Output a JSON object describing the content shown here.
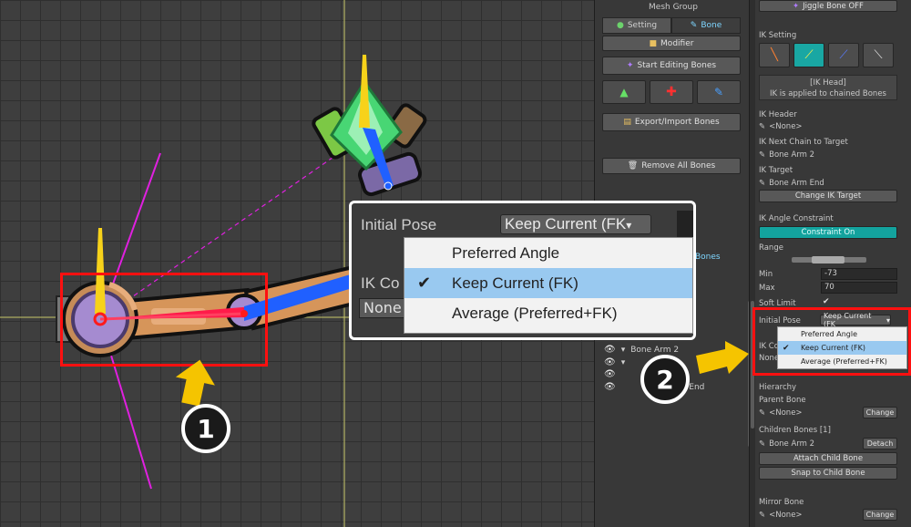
{
  "middle_panel": {
    "title": "Mesh Group",
    "tabs": [
      {
        "label": "Setting",
        "active": false
      },
      {
        "label": "Bone",
        "active": true
      }
    ],
    "modifier_label": "Modifier",
    "start_editing_label": "Start Editing Bones",
    "export_import_label": "Export/Import Bones",
    "remove_all_label": "Remove All Bones",
    "bones_tab_label": "Bones",
    "hierarchy": [
      {
        "label": "Bone Arm 2"
      },
      {
        "label": ""
      },
      {
        "label": "n End"
      }
    ]
  },
  "right_panel": {
    "jiggle_label": "Jiggle Bone OFF",
    "ik_setting_label": "IK Setting",
    "ik_tools": [
      "ik-single-icon",
      "ik-head-icon",
      "ik-chained-icon",
      "ik-disabled-icon"
    ],
    "info_line1": "[IK Head]",
    "info_line2": "IK is applied to chained Bones",
    "ik_header_label": "IK Header",
    "ik_header_value": "<None>",
    "ik_next_chain_label": "IK Next Chain to Target",
    "ik_next_chain_value": "Bone Arm 2",
    "ik_target_label": "IK Target",
    "ik_target_value": "Bone Arm End",
    "change_ik_target_label": "Change IK Target",
    "ik_angle_constraint_label": "IK Angle Constraint",
    "constraint_on_label": "Constraint On",
    "range_label": "Range",
    "min_label": "Min",
    "min_value": "-73",
    "max_label": "Max",
    "max_value": "70",
    "soft_limit_label": "Soft Limit",
    "initial_pose_label": "Initial Pose",
    "initial_pose_value": "Keep Current (FK",
    "ik_co_label": "IK Co",
    "none_short": "None",
    "pose_options": [
      "Preferred Angle",
      "Keep Current (FK)",
      "Average (Preferred+FK)"
    ],
    "selected_option_index": 1,
    "hierarchy_label": "Hierarchy",
    "parent_bone_label": "Parent Bone",
    "parent_bone_value": "<None>",
    "change_label": "Change",
    "children_bones_label": "Children Bones [1]",
    "child_value": "Bone Arm 2",
    "detach_label": "Detach",
    "attach_child_label": "Attach Child Bone",
    "snap_child_label": "Snap to Child Bone",
    "mirror_bone_label": "Mirror Bone",
    "mirror_bone_value": "<None>",
    "mirror_change_label": "Change"
  },
  "zoom_popup": {
    "initial_pose_label": "Initial Pose",
    "dropdown_value": "Keep Current (FK",
    "ik_co_label": "IK Co",
    "none_value": "None",
    "options": [
      "Preferred Angle",
      "Keep Current (FK)",
      "Average (Preferred+FK)"
    ]
  },
  "callouts": {
    "one": "1",
    "two": "2"
  },
  "colors": {
    "accent_teal": "#13a39e",
    "highlight_blue": "#99c9f0",
    "callout_red": "#ff1010",
    "arrow_yellow": "#f5c400"
  }
}
